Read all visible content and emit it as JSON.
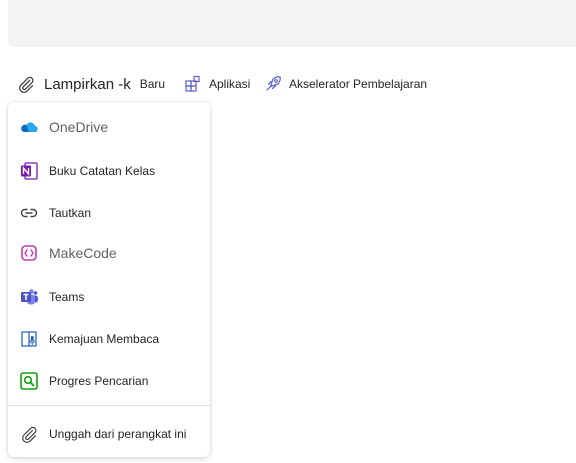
{
  "toolbar": {
    "attach_label": "Lampirkan -k",
    "new_label": "Baru",
    "apps_label": "Aplikasi",
    "accelerator_label": "Akselerator Pembelajaran"
  },
  "menu": {
    "items": [
      {
        "label": "OneDrive",
        "icon": "onedrive-icon"
      },
      {
        "label": "Buku Catatan Kelas",
        "icon": "onenote-icon"
      },
      {
        "label": "Tautkan",
        "icon": "link-icon"
      },
      {
        "label": "MakeCode",
        "icon": "makecode-icon"
      },
      {
        "label": "Teams",
        "icon": "teams-icon"
      },
      {
        "label": "Kemajuan Membaca",
        "icon": "reading-progress-icon"
      },
      {
        "label": "Progres Pencarian",
        "icon": "search-progress-icon"
      }
    ],
    "upload_label": "Unggah dari perangkat ini"
  },
  "colors": {
    "onedrive": "#0f6cbd",
    "onenote": "#7719aa",
    "makecode": "#c239b3",
    "teams": "#5b5fc7",
    "reading": "#2b66b7",
    "search": "#13a10e"
  }
}
